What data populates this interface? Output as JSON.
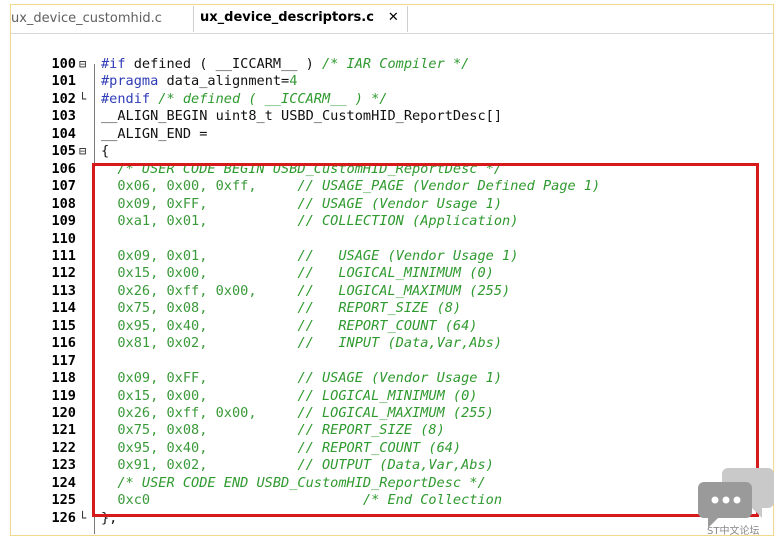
{
  "tabs": [
    {
      "label": "ux_device_customhid.c"
    },
    {
      "label": "ux_device_descriptors.c",
      "close": "✕"
    }
  ],
  "lines": [
    {
      "n": "100",
      "fold": "⊟",
      "parts": [
        [
          "pp",
          "#if"
        ],
        [
          "tx",
          " defined ( "
        ],
        [
          "tx",
          "__ICCARM__"
        ],
        [
          "tx",
          " ) "
        ],
        [
          "cm",
          "/* IAR Compiler */"
        ]
      ]
    },
    {
      "n": "101",
      "fold": "",
      "parts": [
        [
          "pp",
          "#pragma"
        ],
        [
          "tx",
          " data_alignment="
        ],
        [
          "hx",
          "4"
        ]
      ]
    },
    {
      "n": "102",
      "fold": "└",
      "parts": [
        [
          "pp",
          "#endif"
        ],
        [
          "cm",
          " /* defined ( __ICCARM__ ) */"
        ]
      ]
    },
    {
      "n": "103",
      "fold": "",
      "parts": [
        [
          "tx",
          "__ALIGN_BEGIN uint8_t USBD_CustomHID_ReportDesc[]"
        ]
      ]
    },
    {
      "n": "104",
      "fold": "",
      "parts": [
        [
          "tx",
          "__ALIGN_END ="
        ]
      ]
    },
    {
      "n": "105",
      "fold": "⊟",
      "parts": [
        [
          "tx",
          "{"
        ]
      ]
    },
    {
      "n": "106",
      "fold": "",
      "parts": [
        [
          "cm",
          "  /* USER CODE BEGIN USBD_CustomHID_ReportDesc */"
        ]
      ]
    },
    {
      "n": "107",
      "fold": "",
      "parts": [
        [
          "hx",
          "  0x06, 0x00, 0xff,"
        ],
        [
          "tx",
          "     "
        ],
        [
          "cm",
          "// USAGE_PAGE (Vendor Defined Page 1)"
        ]
      ]
    },
    {
      "n": "108",
      "fold": "",
      "parts": [
        [
          "hx",
          "  0x09, 0xFF,"
        ],
        [
          "tx",
          "           "
        ],
        [
          "cm",
          "// USAGE (Vendor Usage 1)"
        ]
      ]
    },
    {
      "n": "109",
      "fold": "",
      "parts": [
        [
          "hx",
          "  0xa1, 0x01,"
        ],
        [
          "tx",
          "           "
        ],
        [
          "cm",
          "// COLLECTION (Application)"
        ]
      ]
    },
    {
      "n": "110",
      "fold": "",
      "parts": []
    },
    {
      "n": "111",
      "fold": "",
      "parts": [
        [
          "hx",
          "  0x09, 0x01,"
        ],
        [
          "tx",
          "           "
        ],
        [
          "cm",
          "//   USAGE (Vendor Usage 1)"
        ]
      ]
    },
    {
      "n": "112",
      "fold": "",
      "parts": [
        [
          "hx",
          "  0x15, 0x00,"
        ],
        [
          "tx",
          "           "
        ],
        [
          "cm",
          "//   LOGICAL_MINIMUM (0)"
        ]
      ]
    },
    {
      "n": "113",
      "fold": "",
      "parts": [
        [
          "hx",
          "  0x26, 0xff, 0x00,"
        ],
        [
          "tx",
          "     "
        ],
        [
          "cm",
          "//   LOGICAL_MAXIMUM (255)"
        ]
      ]
    },
    {
      "n": "114",
      "fold": "",
      "parts": [
        [
          "hx",
          "  0x75, 0x08,"
        ],
        [
          "tx",
          "           "
        ],
        [
          "cm",
          "//   REPORT_SIZE (8)"
        ]
      ]
    },
    {
      "n": "115",
      "fold": "",
      "parts": [
        [
          "hx",
          "  0x95, 0x40,"
        ],
        [
          "tx",
          "           "
        ],
        [
          "cm",
          "//   REPORT_COUNT (64)"
        ]
      ]
    },
    {
      "n": "116",
      "fold": "",
      "parts": [
        [
          "hx",
          "  0x81, 0x02,"
        ],
        [
          "tx",
          "           "
        ],
        [
          "cm",
          "//   INPUT (Data,Var,Abs)"
        ]
      ]
    },
    {
      "n": "117",
      "fold": "",
      "parts": []
    },
    {
      "n": "118",
      "fold": "",
      "parts": [
        [
          "hx",
          "  0x09, 0xFF,"
        ],
        [
          "tx",
          "           "
        ],
        [
          "cm",
          "// USAGE (Vendor Usage 1)"
        ]
      ]
    },
    {
      "n": "119",
      "fold": "",
      "parts": [
        [
          "hx",
          "  0x15, 0x00,"
        ],
        [
          "tx",
          "           "
        ],
        [
          "cm",
          "// LOGICAL_MINIMUM (0)"
        ]
      ]
    },
    {
      "n": "120",
      "fold": "",
      "parts": [
        [
          "hx",
          "  0x26, 0xff, 0x00,"
        ],
        [
          "tx",
          "     "
        ],
        [
          "cm",
          "// LOGICAL_MAXIMUM (255)"
        ]
      ]
    },
    {
      "n": "121",
      "fold": "",
      "parts": [
        [
          "hx",
          "  0x75, 0x08,"
        ],
        [
          "tx",
          "           "
        ],
        [
          "cm",
          "// REPORT_SIZE (8)"
        ]
      ]
    },
    {
      "n": "122",
      "fold": "",
      "parts": [
        [
          "hx",
          "  0x95, 0x40,"
        ],
        [
          "tx",
          "           "
        ],
        [
          "cm",
          "// REPORT_COUNT (64)"
        ]
      ]
    },
    {
      "n": "123",
      "fold": "",
      "parts": [
        [
          "hx",
          "  0x91, 0x02,"
        ],
        [
          "tx",
          "           "
        ],
        [
          "cm",
          "// OUTPUT (Data,Var,Abs)"
        ]
      ]
    },
    {
      "n": "124",
      "fold": "",
      "parts": [
        [
          "cm",
          "  /* USER CODE END USBD_CustomHID_ReportDesc */"
        ]
      ]
    },
    {
      "n": "125",
      "fold": "",
      "parts": [
        [
          "hx",
          "  0xc0"
        ],
        [
          "tx",
          "                          "
        ],
        [
          "cm",
          "/* End Collection"
        ]
      ]
    },
    {
      "n": "126",
      "fold": "└",
      "parts": [
        [
          "tx",
          "};"
        ]
      ]
    }
  ],
  "watermark": {
    "text": "ST中文论坛"
  },
  "colors": {
    "highlight_border": "#d61a1a",
    "comment": "#2f9a2f",
    "preprocessor": "#2f3cb8"
  }
}
